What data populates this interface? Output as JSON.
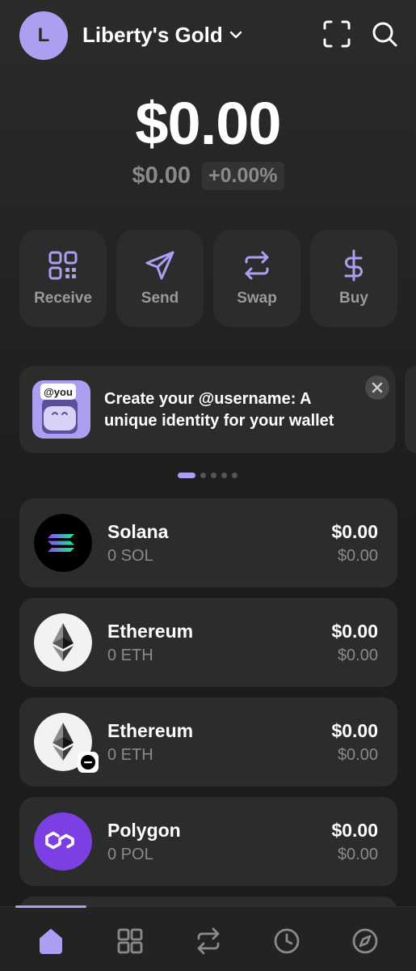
{
  "header": {
    "avatar_letter": "L",
    "account_name": "Liberty's Gold",
    "icons": [
      "chevron-down-icon",
      "scan-icon",
      "search-icon"
    ]
  },
  "balance": {
    "total": "$0.00",
    "change_value": "$0.00",
    "change_percent": "+0.00%"
  },
  "actions": [
    {
      "label": "Receive",
      "icon": "qr-code-icon"
    },
    {
      "label": "Send",
      "icon": "send-icon"
    },
    {
      "label": "Swap",
      "icon": "swap-icon"
    },
    {
      "label": "Buy",
      "icon": "dollar-icon"
    }
  ],
  "promo": {
    "art_label": "@you",
    "text": "Create your @username: A unique identity for your wallet"
  },
  "carousel": {
    "pages": 5,
    "active": 1
  },
  "tokens": [
    {
      "name": "Solana",
      "amount": "0 SOL",
      "value": "$0.00",
      "fiat": "$0.00",
      "icon": "solana-icon"
    },
    {
      "name": "Ethereum",
      "amount": "0 ETH",
      "value": "$0.00",
      "fiat": "$0.00",
      "icon": "ethereum-icon"
    },
    {
      "name": "Ethereum",
      "amount": "0 ETH",
      "value": "$0.00",
      "fiat": "$0.00",
      "icon": "ethereum-icon"
    },
    {
      "name": "Polygon",
      "amount": "0 POL",
      "value": "$0.00",
      "fiat": "$0.00",
      "icon": "polygon-icon"
    }
  ],
  "bottom_nav": [
    {
      "icon": "home-icon",
      "active": true
    },
    {
      "icon": "grid-icon",
      "active": false
    },
    {
      "icon": "swap-icon",
      "active": false
    },
    {
      "icon": "clock-icon",
      "active": false
    },
    {
      "icon": "compass-icon",
      "active": false
    }
  ],
  "colors": {
    "accent": "#ab9ff2",
    "background": "#1c1c1c",
    "card": "#2c2c2d",
    "muted": "#8a8a8a"
  }
}
